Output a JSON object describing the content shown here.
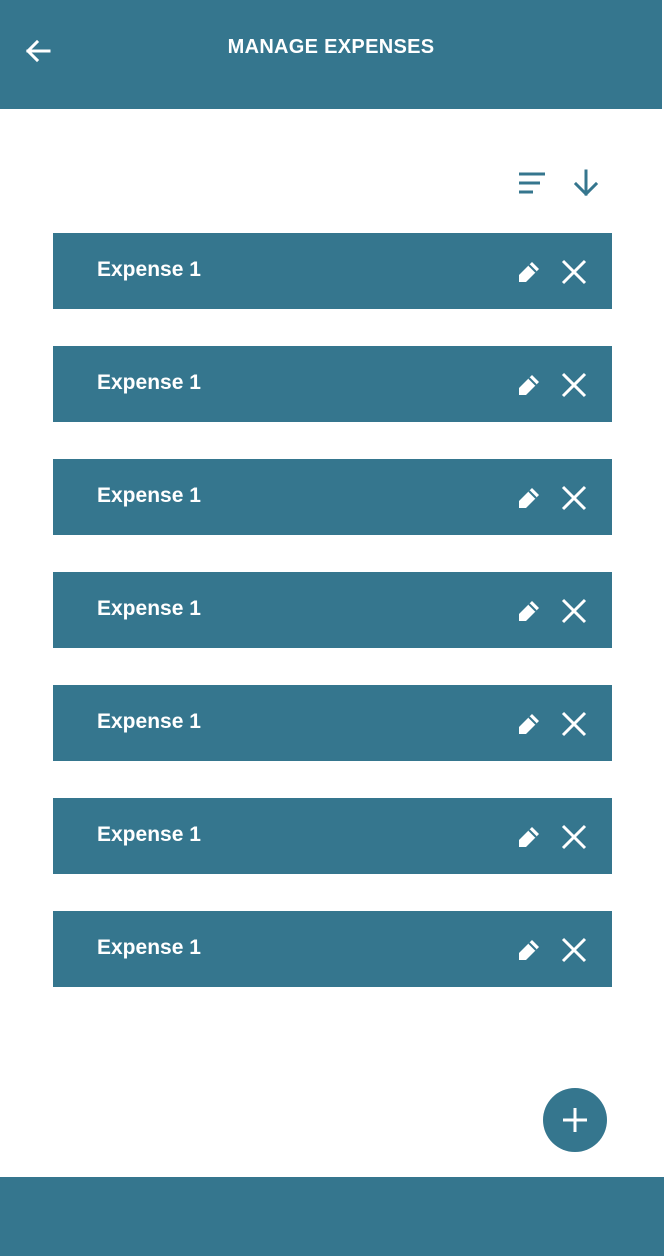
{
  "header": {
    "title": "MANAGE EXPENSES",
    "back_icon": "arrow-left-icon"
  },
  "toolbar": {
    "sort_icon": "sort-lines-icon",
    "direction_icon": "arrow-down-icon"
  },
  "expenses": [
    {
      "label": "Expense 1"
    },
    {
      "label": "Expense 1"
    },
    {
      "label": "Expense 1"
    },
    {
      "label": "Expense 1"
    },
    {
      "label": "Expense 1"
    },
    {
      "label": "Expense 1"
    },
    {
      "label": "Expense 1"
    }
  ],
  "item_icons": {
    "edit": "pencil-icon",
    "delete": "close-icon"
  },
  "fab": {
    "icon": "plus-icon"
  },
  "colors": {
    "primary": "#35768E",
    "on_primary": "#FFFFFF",
    "background": "#FFFFFF"
  }
}
